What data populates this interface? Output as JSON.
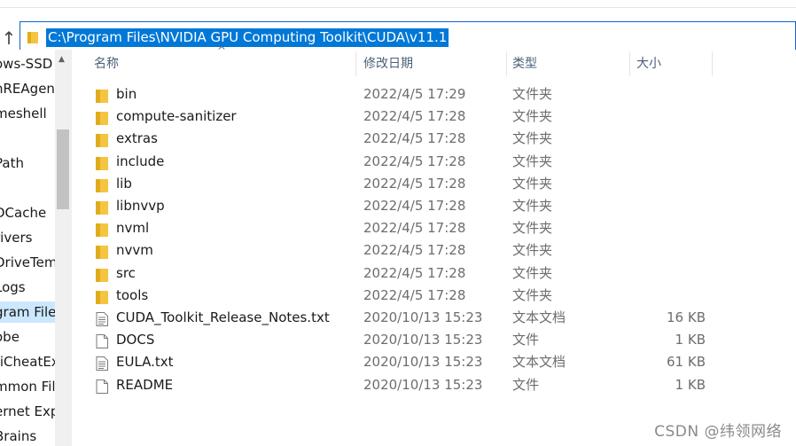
{
  "address_bar": {
    "path": "C:\\Program Files\\NVIDIA GPU Computing Toolkit\\CUDA\\v11.1"
  },
  "nav_pane": {
    "items": [
      {
        "label": "ows-SSD (",
        "selected": false
      },
      {
        "label": "nREAgent",
        "selected": false
      },
      {
        "label": "meshell",
        "selected": false
      },
      {
        "label": "",
        "selected": false
      },
      {
        "label": "Path",
        "selected": false
      },
      {
        "label": "",
        "selected": false
      },
      {
        "label": "DCache",
        "selected": false
      },
      {
        "label": "rivers",
        "selected": false
      },
      {
        "label": "DriveTem",
        "selected": false
      },
      {
        "label": "Logs",
        "selected": false
      },
      {
        "label": "gram Files",
        "selected": true
      },
      {
        "label": "obe",
        "selected": false
      },
      {
        "label": "tiCheatEx",
        "selected": false
      },
      {
        "label": "mmon File",
        "selected": false
      },
      {
        "label": "ernet Exp",
        "selected": false
      },
      {
        "label": "Brains",
        "selected": false
      }
    ]
  },
  "columns": {
    "name": "名称",
    "date": "修改日期",
    "type": "类型",
    "size": "大小"
  },
  "files": [
    {
      "name": "bin",
      "date": "2022/4/5 17:29",
      "type": "文件夹",
      "size": "",
      "kind": "folder"
    },
    {
      "name": "compute-sanitizer",
      "date": "2022/4/5 17:28",
      "type": "文件夹",
      "size": "",
      "kind": "folder"
    },
    {
      "name": "extras",
      "date": "2022/4/5 17:28",
      "type": "文件夹",
      "size": "",
      "kind": "folder"
    },
    {
      "name": "include",
      "date": "2022/4/5 17:28",
      "type": "文件夹",
      "size": "",
      "kind": "folder"
    },
    {
      "name": "lib",
      "date": "2022/4/5 17:28",
      "type": "文件夹",
      "size": "",
      "kind": "folder"
    },
    {
      "name": "libnvvp",
      "date": "2022/4/5 17:28",
      "type": "文件夹",
      "size": "",
      "kind": "folder"
    },
    {
      "name": "nvml",
      "date": "2022/4/5 17:28",
      "type": "文件夹",
      "size": "",
      "kind": "folder"
    },
    {
      "name": "nvvm",
      "date": "2022/4/5 17:28",
      "type": "文件夹",
      "size": "",
      "kind": "folder"
    },
    {
      "name": "src",
      "date": "2022/4/5 17:28",
      "type": "文件夹",
      "size": "",
      "kind": "folder"
    },
    {
      "name": "tools",
      "date": "2022/4/5 17:28",
      "type": "文件夹",
      "size": "",
      "kind": "folder"
    },
    {
      "name": "CUDA_Toolkit_Release_Notes.txt",
      "date": "2020/10/13 15:23",
      "type": "文本文档",
      "size": "16 KB",
      "kind": "textfile"
    },
    {
      "name": "DOCS",
      "date": "2020/10/13 15:23",
      "type": "文件",
      "size": "1 KB",
      "kind": "file"
    },
    {
      "name": "EULA.txt",
      "date": "2020/10/13 15:23",
      "type": "文本文档",
      "size": "61 KB",
      "kind": "textfile"
    },
    {
      "name": "README",
      "date": "2020/10/13 15:23",
      "type": "文件",
      "size": "1 KB",
      "kind": "file"
    }
  ],
  "watermark": "CSDN @纬领网络",
  "colors": {
    "selection": "#0078d7",
    "folder": "#f4c541",
    "nav_selected": "#cce8ff"
  }
}
